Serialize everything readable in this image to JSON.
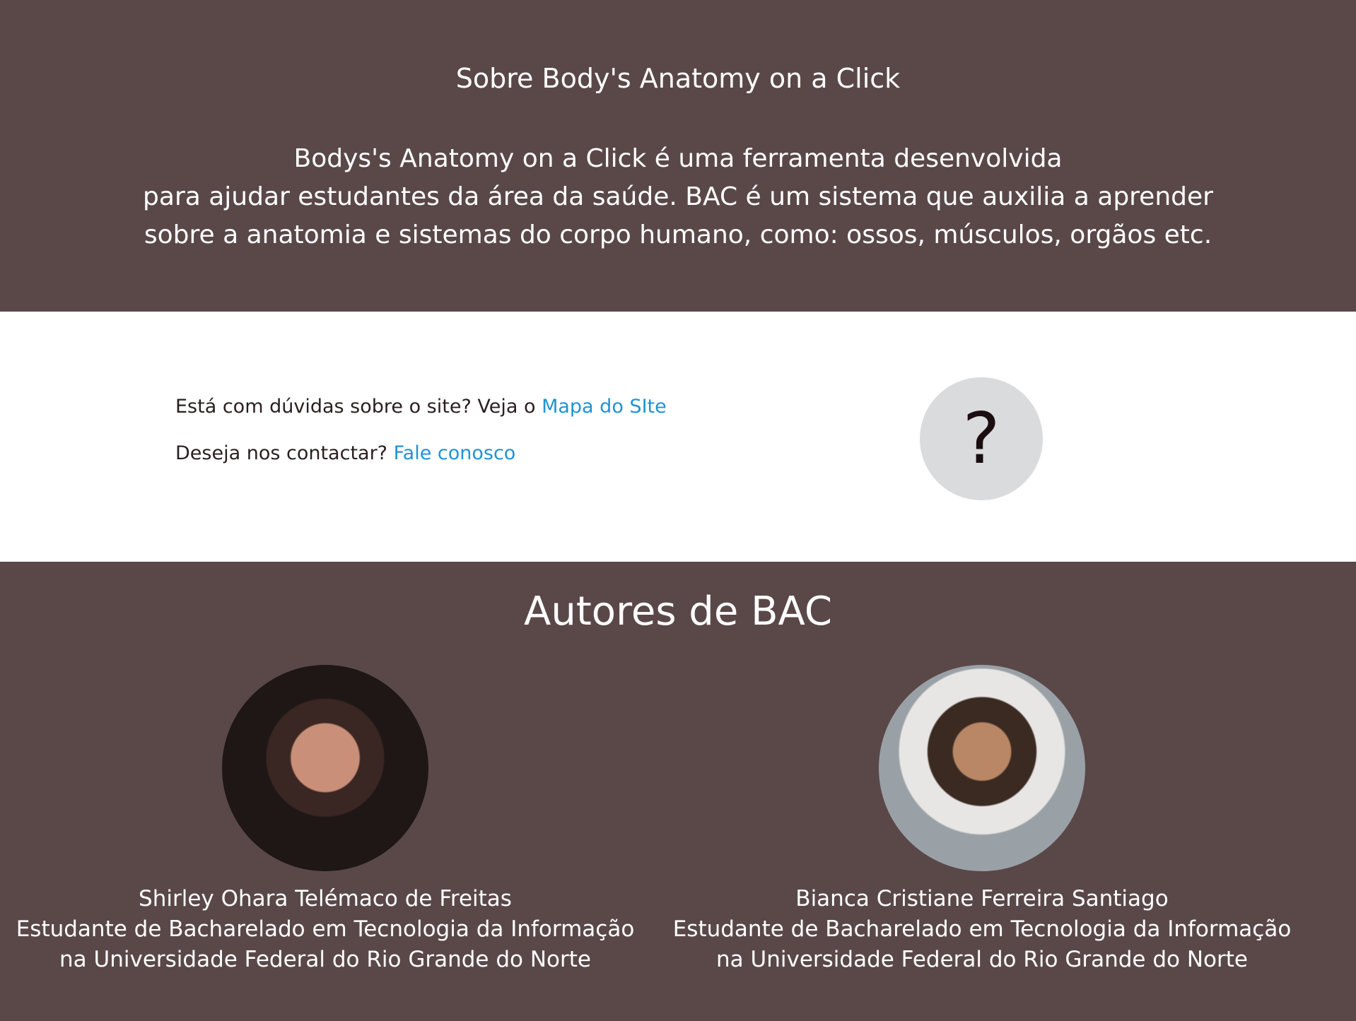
{
  "about": {
    "title": "Sobre Body's Anatomy on a Click",
    "lines": [
      "Bodys's Anatomy on a Click é uma ferramenta desenvolvida",
      "para ajudar estudantes da área da saúde. BAC é um sistema que auxilia a aprender",
      "sobre a anatomia e sistemas do corpo humano, como: ossos, músculos, orgãos etc."
    ]
  },
  "help": {
    "question_1": "Está com dúvidas sobre o site? Veja o ",
    "link_1": "Mapa do SIte",
    "question_2": "Deseja nos contactar? ",
    "link_2": "Fale conosco",
    "circle_symbol": "?",
    "circle_icon": "question-mark-icon"
  },
  "authors": {
    "title": "Autores de BAC",
    "people": [
      {
        "name": "Shirley Ohara Telémaco de Freitas",
        "role_line_1": "Estudante de Bacharelado em Tecnologia da Informação",
        "role_line_2": "na Universidade Federal do Rio Grande do Norte"
      },
      {
        "name": "Bianca Cristiane Ferreira Santiago",
        "role_line_1": "Estudante de Bacharelado em Tecnologia da Informação",
        "role_line_2": "na Universidade Federal do Rio Grande do Norte"
      }
    ]
  }
}
